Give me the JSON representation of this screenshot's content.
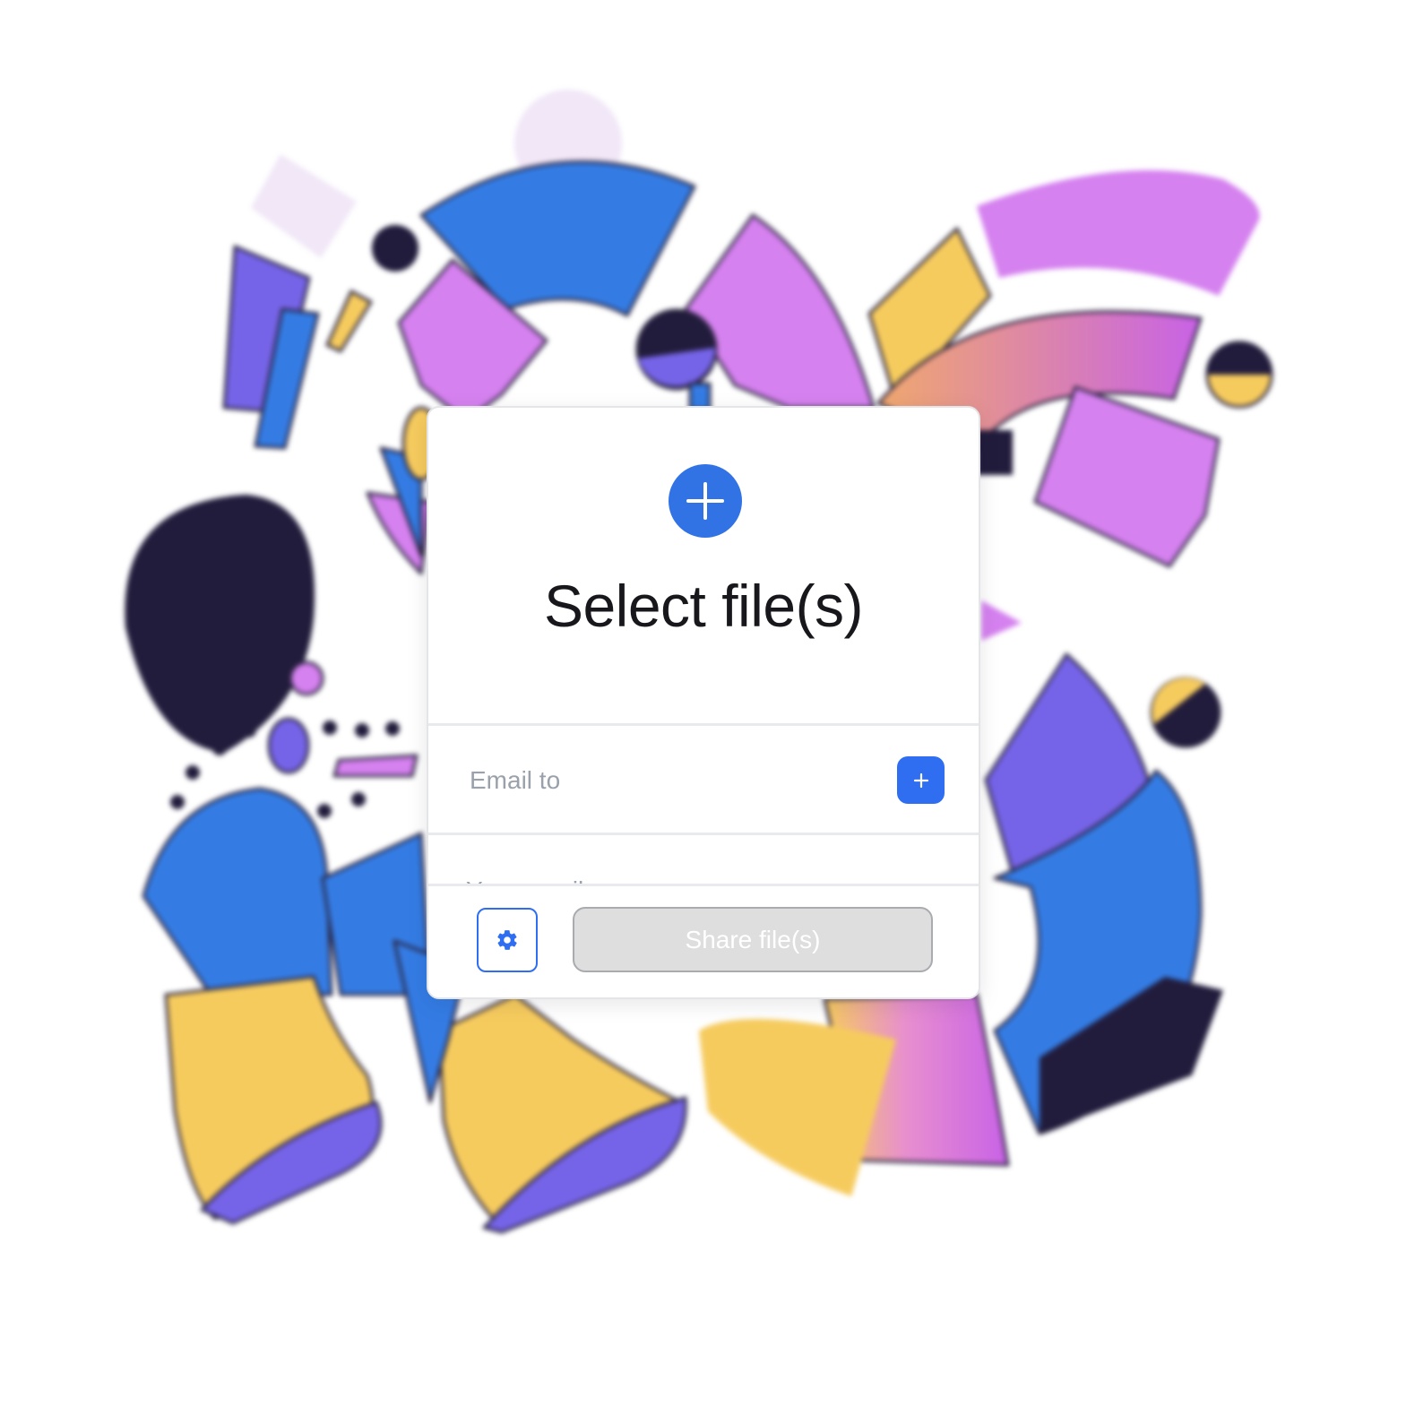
{
  "upload": {
    "title": "Select file(s)",
    "icon": "plus-icon"
  },
  "form": {
    "email_placeholder": "Email to",
    "email_value": "",
    "add_email_icon": "plus-icon",
    "message_placeholder": "Your email",
    "message_value": ""
  },
  "footer": {
    "settings_icon": "gear-icon",
    "share_label": "Share file(s)",
    "share_enabled": false
  },
  "colors": {
    "accent": "#3173e4",
    "disabled_button": "#dedede",
    "illustration_blue": "#347ce4",
    "illustration_pink": "#d581ef",
    "illustration_purple": "#7664e8",
    "illustration_yellow": "#f6cb5e",
    "illustration_navy": "#221c3c"
  }
}
